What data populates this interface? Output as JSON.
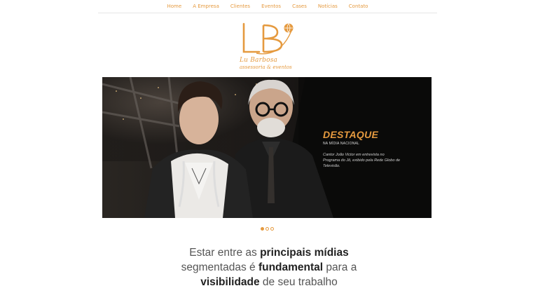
{
  "nav": {
    "items": [
      "Home",
      "A Empresa",
      "Clientes",
      "Eventos",
      "Cases",
      "Notícias",
      "Contato"
    ]
  },
  "logo": {
    "mark": "LB",
    "name": "Lu Barbosa",
    "subtitle": "assessoria & eventos"
  },
  "banner": {
    "title": "DESTAQUE",
    "subtitle": "NA MÍDIA NACIONAL",
    "text": "Cantor João Victor em entrevista no Programa do Jô, exibido pela Rede Globo de Televisão.",
    "slides": 3,
    "active_slide": 1
  },
  "tagline": {
    "p1": "Estar entre as ",
    "b1": "principais mídias",
    "p2": " segmentadas é ",
    "b2": "fundamental",
    "p3": " para a ",
    "b3": "visibilidade",
    "p4": " de seu trabalho"
  },
  "colors": {
    "accent": "#e59a3f",
    "text": "#555555",
    "banner_bg": "#0f0d0c"
  }
}
